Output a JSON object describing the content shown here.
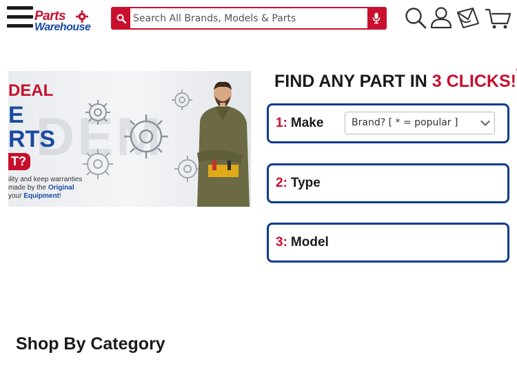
{
  "header": {
    "logo_line1": "Parts",
    "logo_line2": "Warehouse",
    "search_placeholder": "Search All Brands, Models & Parts",
    "icons": [
      "menu-icon",
      "search-icon",
      "account-icon",
      "messages-icon",
      "cart-icon"
    ]
  },
  "banner": {
    "deal": "DEAL",
    "line_e": "E",
    "line_rts": "RTS",
    "badge": "T?",
    "small_line1": "ility and keep warranties",
    "small_line2_pre": "made by the ",
    "small_line2_bold": "Original",
    "small_line3_pre": "your ",
    "small_line3_bold": "Equipment",
    "small_line3_post": "!",
    "bg_text": "DEM"
  },
  "finder": {
    "title_pre": "FIND ANY PART IN ",
    "title_highlight": "3 CLICKS!",
    "title_mark": "®",
    "steps": [
      {
        "num": "1:",
        "label": "Make",
        "select_value": "Brand?  [ * = popular ]"
      },
      {
        "num": "2:",
        "label": "Type"
      },
      {
        "num": "3:",
        "label": "Model"
      }
    ]
  },
  "category": {
    "heading": "Shop By Category"
  },
  "colors": {
    "brand_red": "#c8102e",
    "brand_blue": "#0d3a8c",
    "logo_blue": "#1a4aa0"
  }
}
